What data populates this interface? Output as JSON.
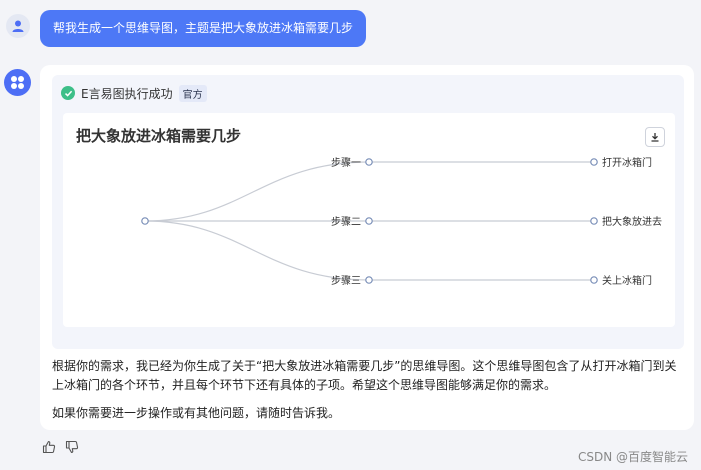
{
  "user_message": "帮我生成一个思维导图，主题是把大象放进冰箱需要几步",
  "tool": {
    "status": "E言易图执行成功",
    "badge": "官方"
  },
  "mindmap": {
    "title": "把大象放进冰箱需要几步",
    "branches": [
      {
        "step": "步骤一",
        "leaf": "打开冰箱门"
      },
      {
        "step": "步骤二",
        "leaf": "把大象放进去"
      },
      {
        "step": "步骤三",
        "leaf": "关上冰箱门"
      }
    ]
  },
  "answer": {
    "paragraph1": "根据你的需求，我已经为你生成了关于“把大象放进冰箱需要几步”的思维导图。这个思维导图包含了从打开冰箱门到关上冰箱门的各个环节，并且每个环节下还有具体的子项。希望这个思维导图能够满足你的需求。",
    "paragraph2": "如果你需要进一步操作或有其他问题，请随时告诉我。"
  },
  "icons": {
    "user_avatar": "user-icon",
    "bot_avatar": "assistant-grid-icon",
    "status": "check-circle-icon",
    "download": "download-icon",
    "like": "thumbs-up-icon",
    "dislike": "thumbs-down-icon"
  },
  "colors": {
    "accent": "#4d78f6",
    "success": "#3dbf88",
    "node_stroke": "#7a8fb8",
    "line": "#c8ccd4"
  },
  "watermark": "CSDN @百度智能云"
}
